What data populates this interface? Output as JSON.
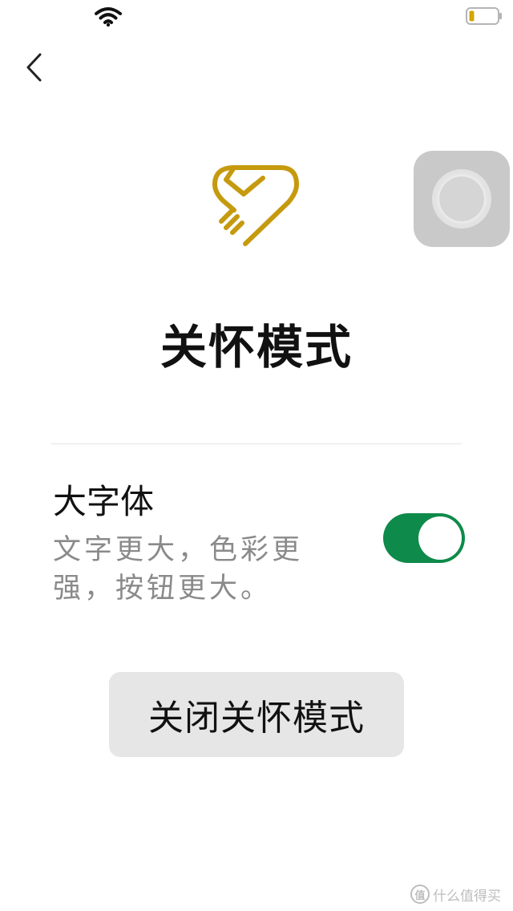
{
  "status_bar": {
    "wifi_icon": "wifi-icon",
    "battery_icon": "battery-low-icon",
    "battery_color": "#d4a500"
  },
  "nav": {
    "back_icon": "chevron-left-icon"
  },
  "logo": {
    "icon": "heart-hand-icon",
    "color": "#c69a0e"
  },
  "page": {
    "title": "关怀模式"
  },
  "setting": {
    "title": "大字体",
    "description": "文字更大，色彩更强，按钮更大。",
    "enabled": true,
    "toggle_color": "#0e8a4a"
  },
  "actions": {
    "close_label": "关闭关怀模式"
  },
  "watermark": {
    "text": "什么值得买",
    "logo_text": "值"
  }
}
